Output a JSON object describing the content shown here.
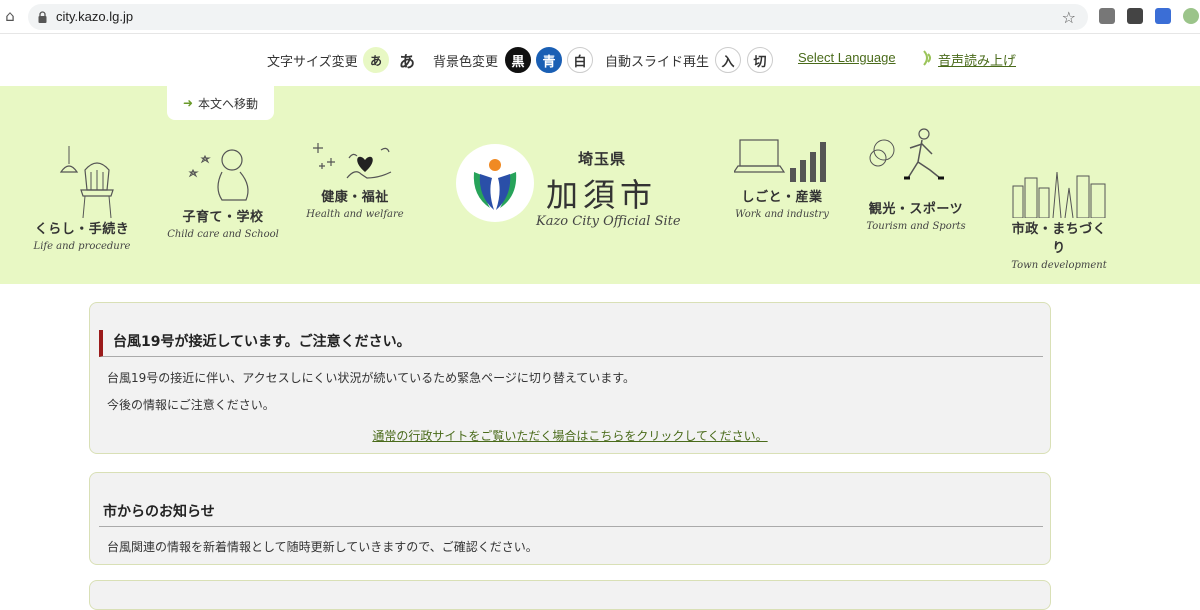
{
  "browser": {
    "url": "city.kazo.lg.jp"
  },
  "utility": {
    "font_size_label": "文字サイズ変更",
    "font_small": "あ",
    "font_large": "あ",
    "bg_color_label": "背景色変更",
    "bg_black": "黒",
    "bg_blue": "青",
    "bg_white": "白",
    "slide_label": "自動スライド再生",
    "slide_on": "入",
    "slide_off": "切",
    "select_language": "Select Language",
    "voice_read": "音声読み上げ"
  },
  "header": {
    "skip_link": "本文へ移動",
    "logo_pref": "埼玉県",
    "logo_name": "加須市",
    "logo_en": "Kazo City Official Site",
    "nav": [
      {
        "jp": "くらし・手続き",
        "en": "Life and procedure"
      },
      {
        "jp": "子育て・学校",
        "en": "Child care and School"
      },
      {
        "jp": "健康・福祉",
        "en": "Health and welfare"
      },
      {
        "jp": "しごと・産業",
        "en": "Work and industry"
      },
      {
        "jp": "観光・スポーツ",
        "en": "Tourism and Sports"
      },
      {
        "jp": "市政・まちづくり",
        "en": "Town development"
      }
    ]
  },
  "notices": [
    {
      "title": "台風19号が接近しています。ご注意ください。",
      "lines": [
        "台風19号の接近に伴い、アクセスしにくい状況が続いているため緊急ページに切り替えています。",
        "今後の情報にご注意ください。"
      ],
      "link": "通常の行政サイトをご覧いただく場合はこちらをクリックしてください。"
    },
    {
      "title": "市からのお知らせ",
      "lines": [
        "台風関連の情報を新着情報として随時更新していきますので、ご確認ください。"
      ]
    }
  ],
  "colors": {
    "header_bg": "#e8f8c4",
    "accent_green": "#4a6b1b",
    "title_bar": "#9b1b1b",
    "bg_blue_btn": "#1a5fb4"
  }
}
